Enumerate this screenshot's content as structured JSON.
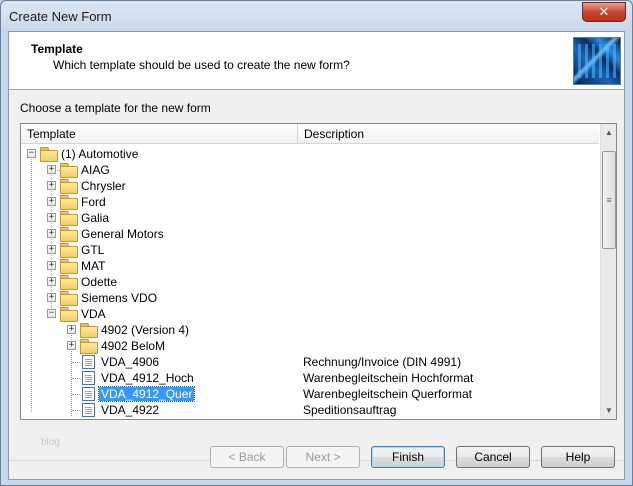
{
  "window": {
    "title": "Create New Form",
    "close_label": "✕"
  },
  "header": {
    "title": "Template",
    "subtitle": "Which template should be used to create the new form?"
  },
  "main": {
    "choose_label": "Choose a template for the new form",
    "columns": {
      "template": "Template",
      "description": "Description"
    }
  },
  "tree": {
    "root": {
      "label": "(1) Automotive"
    },
    "items": [
      {
        "label": "AIAG"
      },
      {
        "label": "Chrysler"
      },
      {
        "label": "Ford"
      },
      {
        "label": "Galia"
      },
      {
        "label": "General Motors"
      },
      {
        "label": "GTL"
      },
      {
        "label": "MAT"
      },
      {
        "label": "Odette"
      },
      {
        "label": "Siemens VDO"
      },
      {
        "label": "VDA"
      },
      {
        "label": "4902 (Version 4)"
      },
      {
        "label": "4902 BeloM"
      },
      {
        "label": "VDA_4906",
        "description": "Rechnung/Invoice (DIN 4991)"
      },
      {
        "label": "VDA_4912_Hoch",
        "description": "Warenbegleitschein Hochformat"
      },
      {
        "label": "VDA_4912_Quer",
        "description": "Warenbegleitschein Querformat",
        "selected": true
      },
      {
        "label": "VDA_4922",
        "description": "Speditionsauftrag"
      }
    ]
  },
  "watermark": "blog",
  "buttons": {
    "back": "< Back",
    "next": "Next >",
    "finish": "Finish",
    "cancel": "Cancel",
    "help": "Help"
  },
  "icons": {
    "scroll_up": "▲",
    "scroll_down": "▼",
    "thumb_grip": "≡",
    "collapse": "−",
    "expand": "+"
  },
  "colors": {
    "selection": "#3399ff",
    "folder": "#f2cf63"
  }
}
